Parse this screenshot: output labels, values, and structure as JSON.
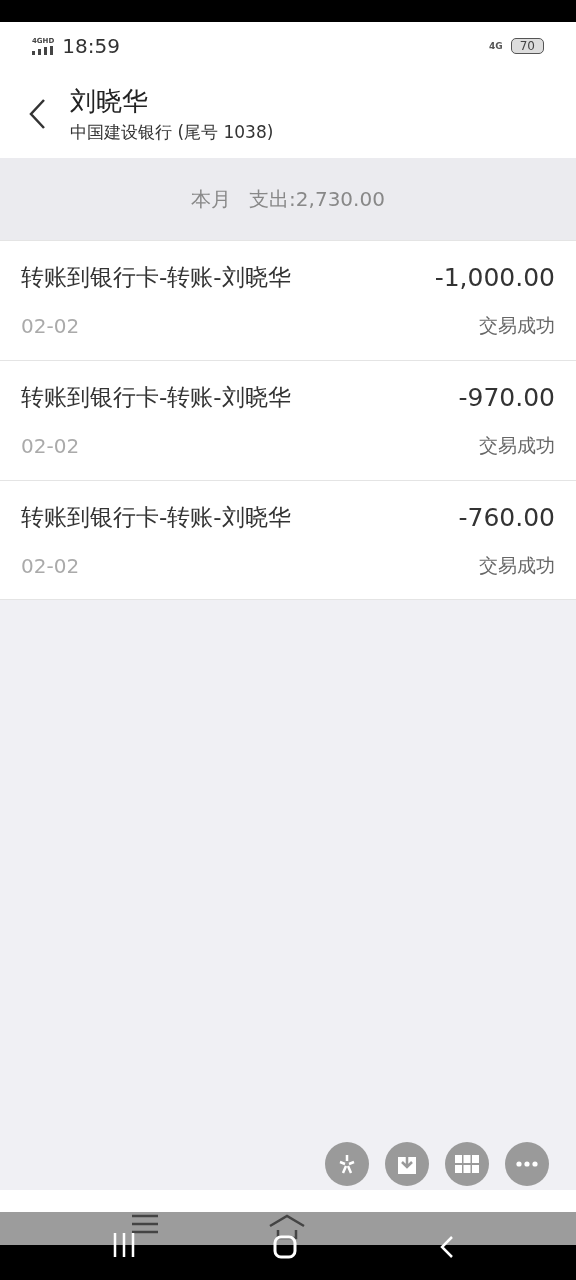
{
  "status_bar": {
    "network": "4GHD",
    "time": "18:59",
    "network_right": "4G",
    "battery": "70"
  },
  "header": {
    "title": "刘晓华",
    "subtitle": "中国建设银行 (尾号 1038)"
  },
  "summary": {
    "period": "本月",
    "total": "支出:2,730.00"
  },
  "transactions": [
    {
      "description": "转账到银行卡-转账-刘晓华",
      "amount": "-1,000.00",
      "date": "02-02",
      "status": "交易成功"
    },
    {
      "description": "转账到银行卡-转账-刘晓华",
      "amount": "-970.00",
      "date": "02-02",
      "status": "交易成功"
    },
    {
      "description": "转账到银行卡-转账-刘晓华",
      "amount": "-760.00",
      "date": "02-02",
      "status": "交易成功"
    }
  ],
  "floating_buttons": [
    {
      "kind": "sparkle"
    },
    {
      "kind": "download"
    },
    {
      "kind": "grid"
    },
    {
      "kind": "more"
    }
  ]
}
